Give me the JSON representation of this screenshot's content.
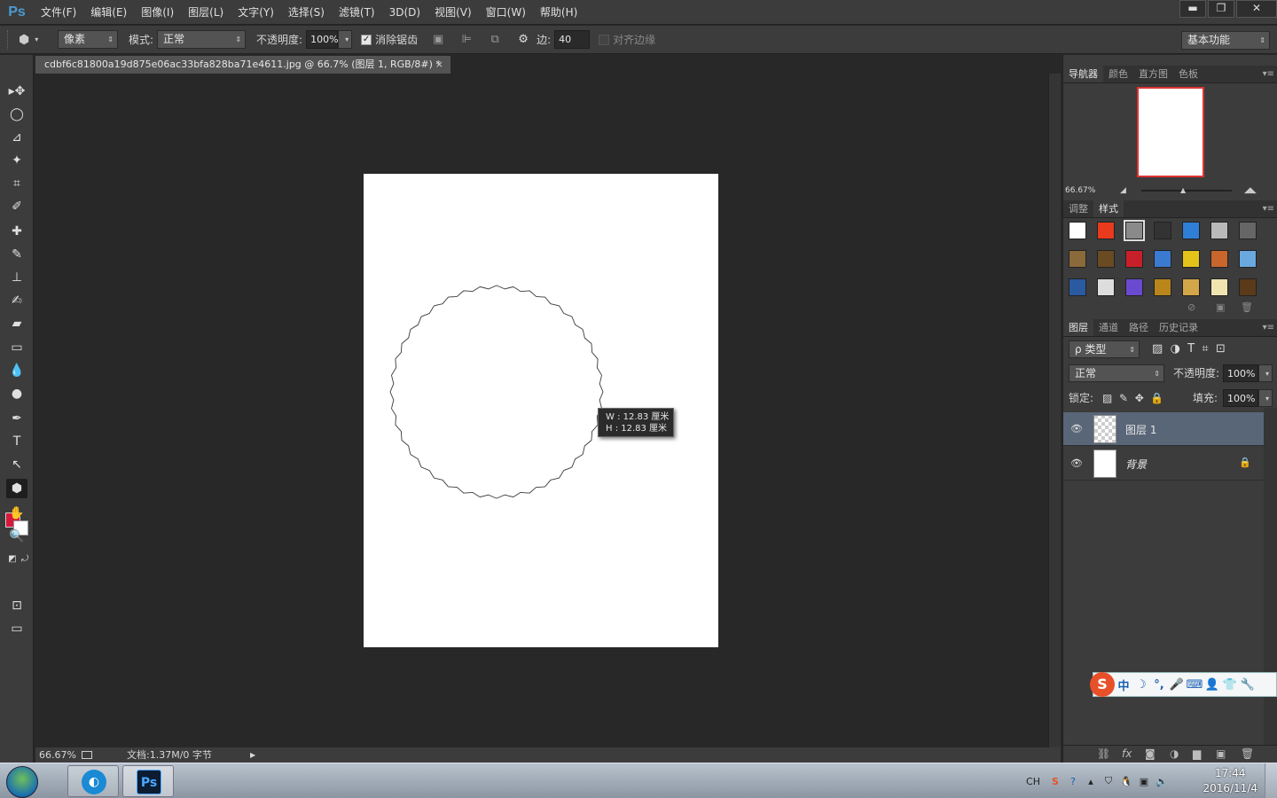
{
  "app": {
    "logo": "Ps"
  },
  "menu": [
    "文件(F)",
    "编辑(E)",
    "图像(I)",
    "图层(L)",
    "文字(Y)",
    "选择(S)",
    "滤镜(T)",
    "3D(D)",
    "视图(V)",
    "窗口(W)",
    "帮助(H)"
  ],
  "window_controls": {
    "minimize": "▬",
    "restore": "❐",
    "close": "✕"
  },
  "options": {
    "tool_mode": "像素",
    "mode_label": "模式:",
    "mode_value": "正常",
    "opacity_label": "不透明度:",
    "opacity_value": "100%",
    "antialias_label": "消除锯齿",
    "antialias_checked": true,
    "sides_label": "边:",
    "sides_value": "40",
    "align_edges_label": "对齐边缘",
    "align_edges_checked": false,
    "workspace": "基本功能"
  },
  "document": {
    "tab_title": "cdbf6c81800a19d875e06ac33bfa828ba71e4611.jpg @ 66.7% (图层 1, RGB/8#) *",
    "tab_close": "×",
    "tooltip_w": "W :  12.83 厘米",
    "tooltip_h": "H :  12.83 厘米",
    "shape": "polygon-star",
    "shape_sides": 40
  },
  "status": {
    "zoom": "66.67%",
    "doc_info": "文档:1.37M/0 字节",
    "arrow": "▶"
  },
  "colors": {
    "foreground": "#d8173d",
    "background": "#ffffff",
    "accent": "#4a9bd4"
  },
  "tools": [
    {
      "name": "move-tool-icon",
      "glyph": "▸✥"
    },
    {
      "name": "ellipse-marquee-icon",
      "glyph": "◯"
    },
    {
      "name": "lasso-icon",
      "glyph": "⊿"
    },
    {
      "name": "magic-wand-icon",
      "glyph": "✦"
    },
    {
      "name": "crop-icon",
      "glyph": "⌗"
    },
    {
      "name": "eyedropper-icon",
      "glyph": "✐"
    },
    {
      "name": "healing-brush-icon",
      "glyph": "✚"
    },
    {
      "name": "brush-icon",
      "glyph": "✎"
    },
    {
      "name": "stamp-icon",
      "glyph": "⊥"
    },
    {
      "name": "history-brush-icon",
      "glyph": "✍"
    },
    {
      "name": "eraser-icon",
      "glyph": "▰"
    },
    {
      "name": "gradient-icon",
      "glyph": "▭"
    },
    {
      "name": "blur-icon",
      "glyph": "💧"
    },
    {
      "name": "dodge-icon",
      "glyph": "●"
    },
    {
      "name": "pen-icon",
      "glyph": "✒"
    },
    {
      "name": "type-icon",
      "glyph": "T"
    },
    {
      "name": "path-select-icon",
      "glyph": "↖"
    },
    {
      "name": "shape-icon",
      "glyph": "⬢"
    },
    {
      "name": "hand-icon",
      "glyph": "✋"
    },
    {
      "name": "zoom-icon",
      "glyph": "🔍"
    }
  ],
  "navigator": {
    "tabs": [
      "导航器",
      "颜色",
      "直方图",
      "色板"
    ],
    "zoom": "66.67%"
  },
  "styles_panel": {
    "tabs": [
      "调整",
      "样式"
    ],
    "swatches": [
      "#ffffff",
      "#e83a1c",
      "#8a8a8a",
      "#333333",
      "#2f7fd6",
      "#b9b9b9",
      "#666666",
      "#8a6a3a",
      "#6a4a22",
      "#c8202a",
      "#3a7ad0",
      "#e3c31a",
      "#c8662c",
      "#6aa8e0",
      "#2a5aa0",
      "#dddddd",
      "#6a4ad0",
      "#b8861a",
      "#d4a64a",
      "#f0e4b0",
      "#5a3a18"
    ]
  },
  "layers_panel": {
    "tabs": [
      "图层",
      "通道",
      "路径",
      "历史记录"
    ],
    "filter": "ρ 类型",
    "blend_mode": "正常",
    "opacity_label": "不透明度:",
    "opacity_value": "100%",
    "lock_label": "锁定:",
    "fill_label": "填充:",
    "fill_value": "100%",
    "layers": [
      {
        "name": "图层 1",
        "selected": true,
        "visible": true,
        "locked": false
      },
      {
        "name": "背景",
        "selected": false,
        "visible": true,
        "locked": true
      }
    ]
  },
  "ime": {
    "logo": "S",
    "items": [
      "中",
      "☽",
      "°,",
      "🎤",
      "⌨",
      "👤",
      "👕",
      "🔧"
    ]
  },
  "taskbar": {
    "tray_lang": "CH",
    "time": "17:44",
    "date": "2016/11/4"
  }
}
